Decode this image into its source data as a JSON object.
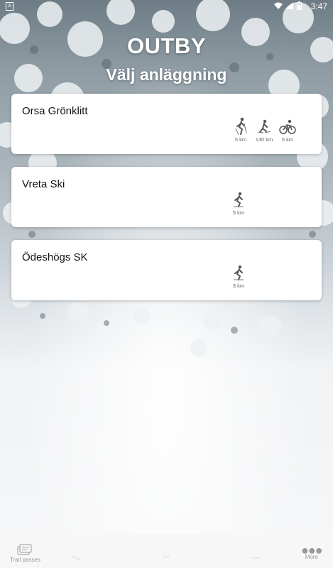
{
  "status_bar": {
    "time": "3:47",
    "icons": [
      "notification-icon",
      "wifi-icon",
      "signal-icon",
      "battery-icon"
    ]
  },
  "header": {
    "brand": "OUTBY",
    "subtitle": "Välj anläggning"
  },
  "facilities": [
    {
      "name": "Orsa Grönklitt",
      "activities": [
        {
          "icon": "cross-country-ski-icon",
          "distance": "5 km"
        },
        {
          "icon": "skate-ski-icon",
          "distance": "130 km"
        },
        {
          "icon": "bicycle-icon",
          "distance": "5 km"
        }
      ]
    },
    {
      "name": "Vreta Ski",
      "activities": [
        {
          "icon": "cross-country-ski-icon",
          "distance": "5 km"
        }
      ]
    },
    {
      "name": "Ödeshögs SK",
      "activities": [
        {
          "icon": "cross-country-ski-icon",
          "distance": "3 km"
        }
      ]
    }
  ],
  "bottom_nav": {
    "left_label": "Trail passes",
    "right_label": "More"
  },
  "colors": {
    "text": "#111111",
    "muted": "#666666",
    "card": "#ffffff"
  }
}
